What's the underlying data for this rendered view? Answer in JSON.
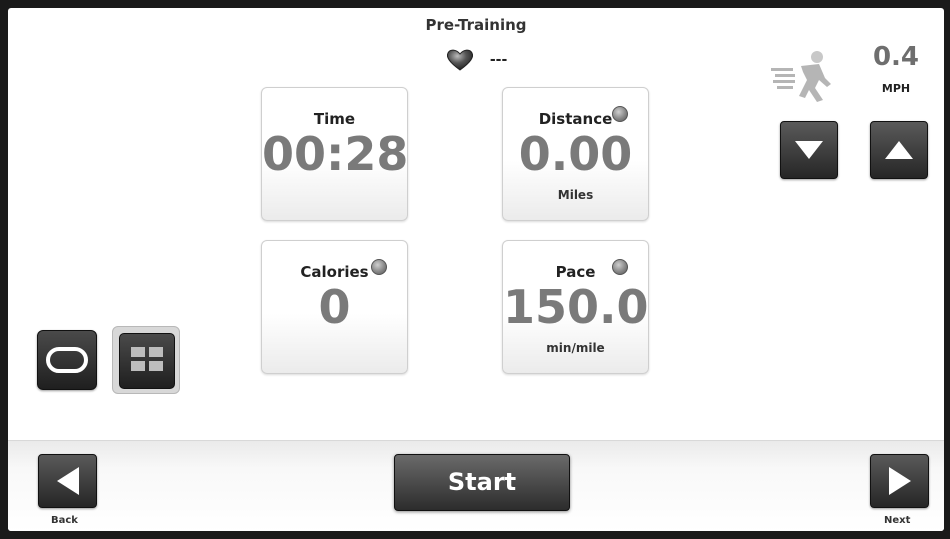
{
  "header": {
    "title": "Pre-Training",
    "heart_rate": "---"
  },
  "speed": {
    "value": "0.4",
    "unit": "MPH"
  },
  "tiles": {
    "time": {
      "label": "Time",
      "value": "00:28"
    },
    "distance": {
      "label": "Distance",
      "value": "0.00",
      "unit": "Miles"
    },
    "calories": {
      "label": "Calories",
      "value": "0"
    },
    "pace": {
      "label": "Pace",
      "value": "150.0",
      "unit": "min/mile"
    }
  },
  "footer": {
    "back_label": "Back",
    "start_label": "Start",
    "next_label": "Next"
  },
  "icons": [
    "heart-icon",
    "runner-icon",
    "speed-down-icon",
    "speed-up-icon",
    "track-view-icon",
    "grid-view-icon",
    "back-arrow-icon",
    "next-arrow-icon"
  ],
  "colors": {
    "value_gray": "#7a7a7a",
    "button_dark": "#2c2c2c"
  }
}
